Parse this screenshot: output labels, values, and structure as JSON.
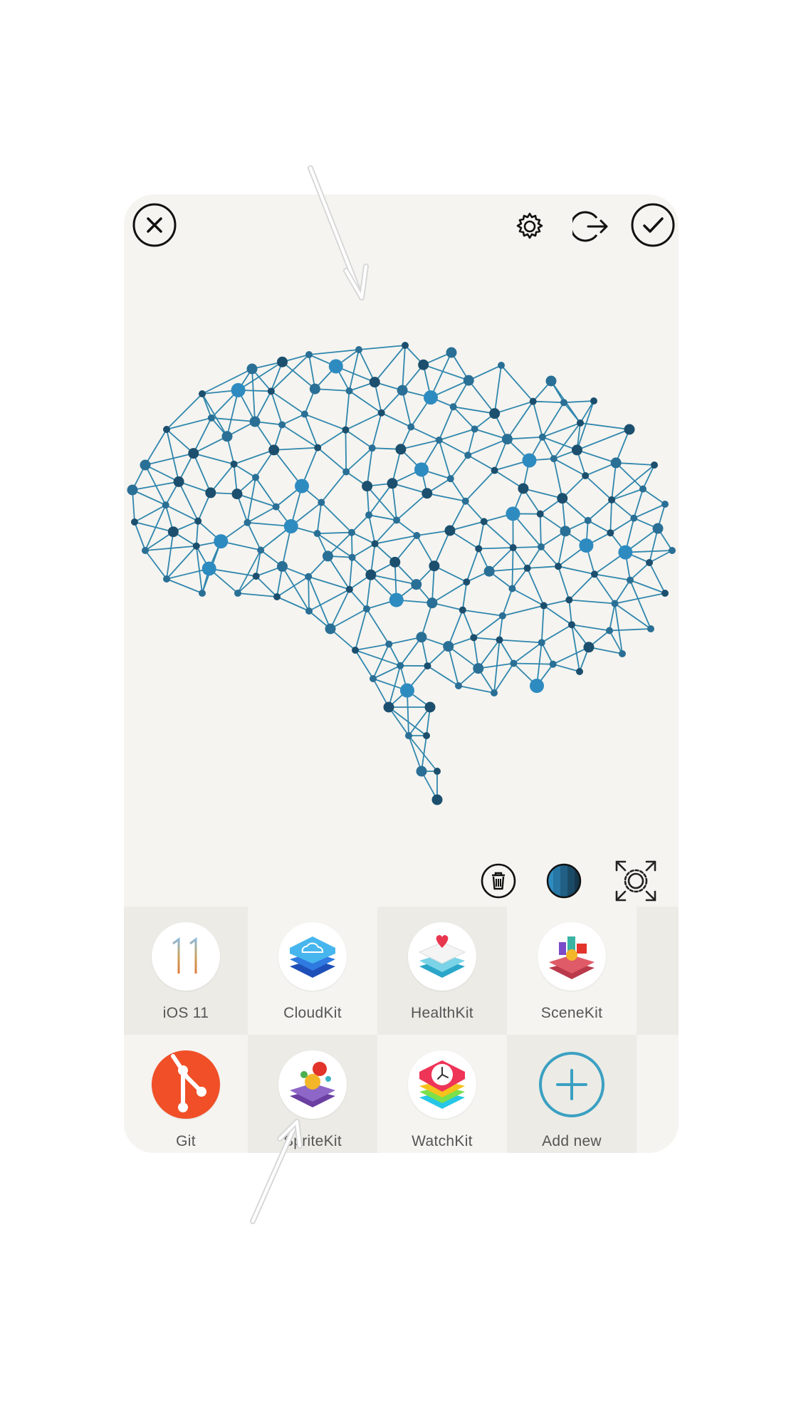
{
  "toolbar": {
    "close": "close-icon",
    "settings": "gear-icon",
    "export": "export-icon",
    "confirm": "checkmark-icon"
  },
  "tools": {
    "delete": "trash-icon",
    "color": "color-swatch",
    "fit": "fit-screen-icon"
  },
  "colors": {
    "node_light": "#2e8bc0",
    "node_dark": "#1c4f6e",
    "edge": "#2f86ad",
    "accent": "#3aa0c2"
  },
  "apps": [
    {
      "label": "iOS 11",
      "icon": "ios11-icon"
    },
    {
      "label": "CloudKit",
      "icon": "cloudkit-icon"
    },
    {
      "label": "HealthKit",
      "icon": "healthkit-icon"
    },
    {
      "label": "SceneKit",
      "icon": "scenekit-icon"
    },
    {
      "label": "Git",
      "icon": "git-icon"
    },
    {
      "label": "SpriteKit",
      "icon": "spritekit-icon"
    },
    {
      "label": "WatchKit",
      "icon": "watchkit-icon"
    },
    {
      "label": "Add new",
      "icon": "add-icon"
    }
  ]
}
